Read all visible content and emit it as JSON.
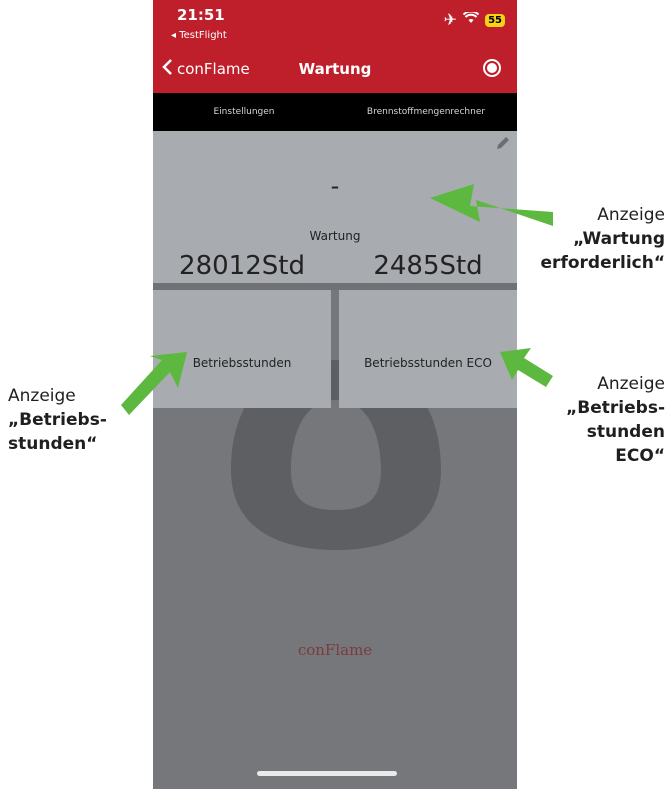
{
  "status_bar": {
    "time": "21:51",
    "back_app": "◂ TestFlight",
    "battery": "55"
  },
  "nav": {
    "back_label": "conFlame",
    "title": "Wartung"
  },
  "tabs": [
    {
      "label": "Einstellungen"
    },
    {
      "label": "Brennstoffmengenrechner"
    }
  ],
  "wartung": {
    "value": "-",
    "label": "Wartung"
  },
  "betriebsstunden": {
    "value": "28012Std",
    "label": "Betriebsstunden"
  },
  "betriebsstunden_eco": {
    "value": "2485Std",
    "label": "Betriebsstunden ECO"
  },
  "brand": "conFlame",
  "annotations": {
    "wartung": {
      "line1": "Anzeige",
      "line2": "„Wartung",
      "line3": "erforderlich“"
    },
    "betriebsstunden": {
      "line1": "Anzeige",
      "line2": "„Betriebs-",
      "line3": "stunden“"
    },
    "eco": {
      "line1": "Anzeige",
      "line2": "„Betriebs-",
      "line3": "stunden",
      "line4": "ECO“"
    }
  },
  "colors": {
    "header": "#bf1f2b",
    "accent_arrow": "#5cb83f",
    "card": "#a8abaf",
    "brand_text": "#7c3b3f"
  }
}
